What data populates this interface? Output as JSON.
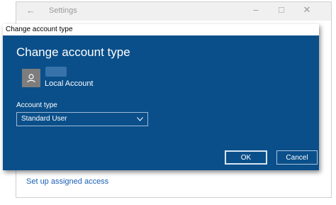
{
  "settings_window": {
    "title": "Settings",
    "back_icon": "back-arrow-icon",
    "link_text": "Set up assigned access"
  },
  "dialog": {
    "title": "Change account type",
    "heading": "Change account type",
    "avatar_icon": "user-icon",
    "account_name": "Local Account",
    "field_label": "Account type",
    "select_value": "Standard User",
    "ok_label": "OK",
    "cancel_label": "Cancel"
  },
  "colors": {
    "dialog_bg": "#0a4f8a",
    "link": "#1a5fb4"
  }
}
